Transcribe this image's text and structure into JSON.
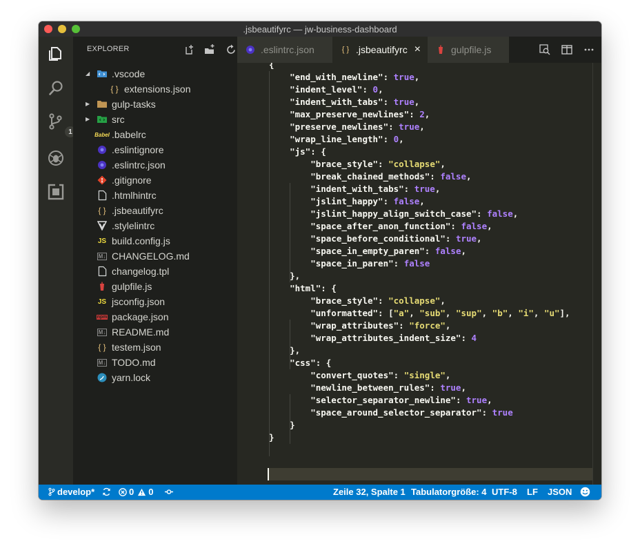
{
  "window": {
    "title": ".jsbeautifyrc — jw-business-dashboard"
  },
  "activity": {
    "scm_badge": "1"
  },
  "sidebar": {
    "title": "EXPLORER",
    "items": [
      {
        "label": ".vscode",
        "icon": "folder-vscode-icon",
        "level": 0,
        "twisty": "open"
      },
      {
        "label": "extensions.json",
        "icon": "json-braces-icon",
        "level": 1,
        "twisty": ""
      },
      {
        "label": "gulp-tasks",
        "icon": "folder-icon",
        "level": 0,
        "twisty": "closed"
      },
      {
        "label": "src",
        "icon": "folder-src-icon",
        "level": 0,
        "twisty": "closed"
      },
      {
        "label": ".babelrc",
        "icon": "babel-icon",
        "level": 0,
        "twisty": ""
      },
      {
        "label": ".eslintignore",
        "icon": "eslint-icon",
        "level": 0,
        "twisty": ""
      },
      {
        "label": ".eslintrc.json",
        "icon": "eslint-icon",
        "level": 0,
        "twisty": ""
      },
      {
        "label": ".gitignore",
        "icon": "git-icon",
        "level": 0,
        "twisty": ""
      },
      {
        "label": ".htmlhintrc",
        "icon": "file-icon",
        "level": 0,
        "twisty": ""
      },
      {
        "label": ".jsbeautifyrc",
        "icon": "json-braces-icon",
        "level": 0,
        "twisty": ""
      },
      {
        "label": ".stylelintrc",
        "icon": "stylelint-icon",
        "level": 0,
        "twisty": ""
      },
      {
        "label": "build.config.js",
        "icon": "js-icon",
        "level": 0,
        "twisty": ""
      },
      {
        "label": "CHANGELOG.md",
        "icon": "markdown-icon",
        "level": 0,
        "twisty": ""
      },
      {
        "label": "changelog.tpl",
        "icon": "file-icon",
        "level": 0,
        "twisty": ""
      },
      {
        "label": "gulpfile.js",
        "icon": "gulp-icon",
        "level": 0,
        "twisty": ""
      },
      {
        "label": "jsconfig.json",
        "icon": "jsconfig-icon",
        "level": 0,
        "twisty": ""
      },
      {
        "label": "package.json",
        "icon": "npm-icon",
        "level": 0,
        "twisty": ""
      },
      {
        "label": "README.md",
        "icon": "markdown-icon",
        "level": 0,
        "twisty": ""
      },
      {
        "label": "testem.json",
        "icon": "json-braces-icon",
        "level": 0,
        "twisty": ""
      },
      {
        "label": "TODO.md",
        "icon": "markdown-icon",
        "level": 0,
        "twisty": ""
      },
      {
        "label": "yarn.lock",
        "icon": "yarn-icon",
        "level": 0,
        "twisty": ""
      }
    ]
  },
  "tabs": [
    {
      "label": ".eslintrc.json",
      "icon": "eslint-icon",
      "active": false
    },
    {
      "label": ".jsbeautifyrc",
      "icon": "json-braces-icon",
      "active": true,
      "close": "×"
    },
    {
      "label": "gulpfile.js",
      "icon": "gulp-icon",
      "active": false
    }
  ],
  "colors": {
    "key": "#f8f8f2",
    "string": "#e6db74",
    "boolean": "#ae81ff",
    "number": "#ae81ff",
    "status_bar": "#007acc",
    "editor_bg": "#272822"
  },
  "code": {
    "lines": [
      [
        {
          "t": "{",
          "c": "p"
        }
      ],
      [
        {
          "t": "    \"end_with_newline\"",
          "c": "k"
        },
        {
          "t": ": ",
          "c": "p"
        },
        {
          "t": "true",
          "c": "b"
        },
        {
          "t": ",",
          "c": "p"
        }
      ],
      [
        {
          "t": "    \"indent_level\"",
          "c": "k"
        },
        {
          "t": ": ",
          "c": "p"
        },
        {
          "t": "0",
          "c": "n"
        },
        {
          "t": ",",
          "c": "p"
        }
      ],
      [
        {
          "t": "    \"indent_with_tabs\"",
          "c": "k"
        },
        {
          "t": ": ",
          "c": "p"
        },
        {
          "t": "true",
          "c": "b"
        },
        {
          "t": ",",
          "c": "p"
        }
      ],
      [
        {
          "t": "    \"max_preserve_newlines\"",
          "c": "k"
        },
        {
          "t": ": ",
          "c": "p"
        },
        {
          "t": "2",
          "c": "n"
        },
        {
          "t": ",",
          "c": "p"
        }
      ],
      [
        {
          "t": "    \"preserve_newlines\"",
          "c": "k"
        },
        {
          "t": ": ",
          "c": "p"
        },
        {
          "t": "true",
          "c": "b"
        },
        {
          "t": ",",
          "c": "p"
        }
      ],
      [
        {
          "t": "    \"wrap_line_length\"",
          "c": "k"
        },
        {
          "t": ": ",
          "c": "p"
        },
        {
          "t": "0",
          "c": "n"
        },
        {
          "t": ",",
          "c": "p"
        }
      ],
      [
        {
          "t": "    \"js\"",
          "c": "k"
        },
        {
          "t": ": {",
          "c": "p"
        }
      ],
      [
        {
          "t": "        \"brace_style\"",
          "c": "k"
        },
        {
          "t": ": ",
          "c": "p"
        },
        {
          "t": "\"collapse\"",
          "c": "s"
        },
        {
          "t": ",",
          "c": "p"
        }
      ],
      [
        {
          "t": "        \"break_chained_methods\"",
          "c": "k"
        },
        {
          "t": ": ",
          "c": "p"
        },
        {
          "t": "false",
          "c": "b"
        },
        {
          "t": ",",
          "c": "p"
        }
      ],
      [
        {
          "t": "        \"indent_with_tabs\"",
          "c": "k"
        },
        {
          "t": ": ",
          "c": "p"
        },
        {
          "t": "true",
          "c": "b"
        },
        {
          "t": ",",
          "c": "p"
        }
      ],
      [
        {
          "t": "        \"jslint_happy\"",
          "c": "k"
        },
        {
          "t": ": ",
          "c": "p"
        },
        {
          "t": "false",
          "c": "b"
        },
        {
          "t": ",",
          "c": "p"
        }
      ],
      [
        {
          "t": "        \"jslint_happy_align_switch_case\"",
          "c": "k"
        },
        {
          "t": ": ",
          "c": "p"
        },
        {
          "t": "false",
          "c": "b"
        },
        {
          "t": ",",
          "c": "p"
        }
      ],
      [
        {
          "t": "        \"space_after_anon_function\"",
          "c": "k"
        },
        {
          "t": ": ",
          "c": "p"
        },
        {
          "t": "false",
          "c": "b"
        },
        {
          "t": ",",
          "c": "p"
        }
      ],
      [
        {
          "t": "        \"space_before_conditional\"",
          "c": "k"
        },
        {
          "t": ": ",
          "c": "p"
        },
        {
          "t": "true",
          "c": "b"
        },
        {
          "t": ",",
          "c": "p"
        }
      ],
      [
        {
          "t": "        \"space_in_empty_paren\"",
          "c": "k"
        },
        {
          "t": ": ",
          "c": "p"
        },
        {
          "t": "false",
          "c": "b"
        },
        {
          "t": ",",
          "c": "p"
        }
      ],
      [
        {
          "t": "        \"space_in_paren\"",
          "c": "k"
        },
        {
          "t": ": ",
          "c": "p"
        },
        {
          "t": "false",
          "c": "b"
        }
      ],
      [
        {
          "t": "    },",
          "c": "p"
        }
      ],
      [
        {
          "t": "    \"html\"",
          "c": "k"
        },
        {
          "t": ": {",
          "c": "p"
        }
      ],
      [
        {
          "t": "        \"brace_style\"",
          "c": "k"
        },
        {
          "t": ": ",
          "c": "p"
        },
        {
          "t": "\"collapse\"",
          "c": "s"
        },
        {
          "t": ",",
          "c": "p"
        }
      ],
      [
        {
          "t": "        \"unformatted\"",
          "c": "k"
        },
        {
          "t": ": [",
          "c": "p"
        },
        {
          "t": "\"a\"",
          "c": "s"
        },
        {
          "t": ", ",
          "c": "p"
        },
        {
          "t": "\"sub\"",
          "c": "s"
        },
        {
          "t": ", ",
          "c": "p"
        },
        {
          "t": "\"sup\"",
          "c": "s"
        },
        {
          "t": ", ",
          "c": "p"
        },
        {
          "t": "\"b\"",
          "c": "s"
        },
        {
          "t": ", ",
          "c": "p"
        },
        {
          "t": "\"i\"",
          "c": "s"
        },
        {
          "t": ", ",
          "c": "p"
        },
        {
          "t": "\"u\"",
          "c": "s"
        },
        {
          "t": "],",
          "c": "p"
        }
      ],
      [
        {
          "t": "        \"wrap_attributes\"",
          "c": "k"
        },
        {
          "t": ": ",
          "c": "p"
        },
        {
          "t": "\"force\"",
          "c": "s"
        },
        {
          "t": ",",
          "c": "p"
        }
      ],
      [
        {
          "t": "        \"wrap_attributes_indent_size\"",
          "c": "k"
        },
        {
          "t": ": ",
          "c": "p"
        },
        {
          "t": "4",
          "c": "n"
        }
      ],
      [
        {
          "t": "    },",
          "c": "p"
        }
      ],
      [
        {
          "t": "    \"css\"",
          "c": "k"
        },
        {
          "t": ": {",
          "c": "p"
        }
      ],
      [
        {
          "t": "        \"convert_quotes\"",
          "c": "k"
        },
        {
          "t": ": ",
          "c": "p"
        },
        {
          "t": "\"single\"",
          "c": "s"
        },
        {
          "t": ",",
          "c": "p"
        }
      ],
      [
        {
          "t": "        \"newline_between_rules\"",
          "c": "k"
        },
        {
          "t": ": ",
          "c": "p"
        },
        {
          "t": "true",
          "c": "b"
        },
        {
          "t": ",",
          "c": "p"
        }
      ],
      [
        {
          "t": "        \"selector_separator_newline\"",
          "c": "k"
        },
        {
          "t": ": ",
          "c": "p"
        },
        {
          "t": "true",
          "c": "b"
        },
        {
          "t": ",",
          "c": "p"
        }
      ],
      [
        {
          "t": "        \"space_around_selector_separator\"",
          "c": "k"
        },
        {
          "t": ": ",
          "c": "p"
        },
        {
          "t": "true",
          "c": "b"
        }
      ],
      [
        {
          "t": "    }",
          "c": "p"
        }
      ],
      [
        {
          "t": "}",
          "c": "p"
        }
      ],
      [
        {
          "t": "",
          "c": "p"
        }
      ]
    ]
  },
  "statusbar": {
    "branch": "develop*",
    "errors": "0",
    "warnings": "0",
    "position": "Zeile 32, Spalte 1",
    "tabsize": "Tabulatorgröße: 4",
    "encoding": "UTF-8",
    "eol": "LF",
    "language": "JSON"
  }
}
